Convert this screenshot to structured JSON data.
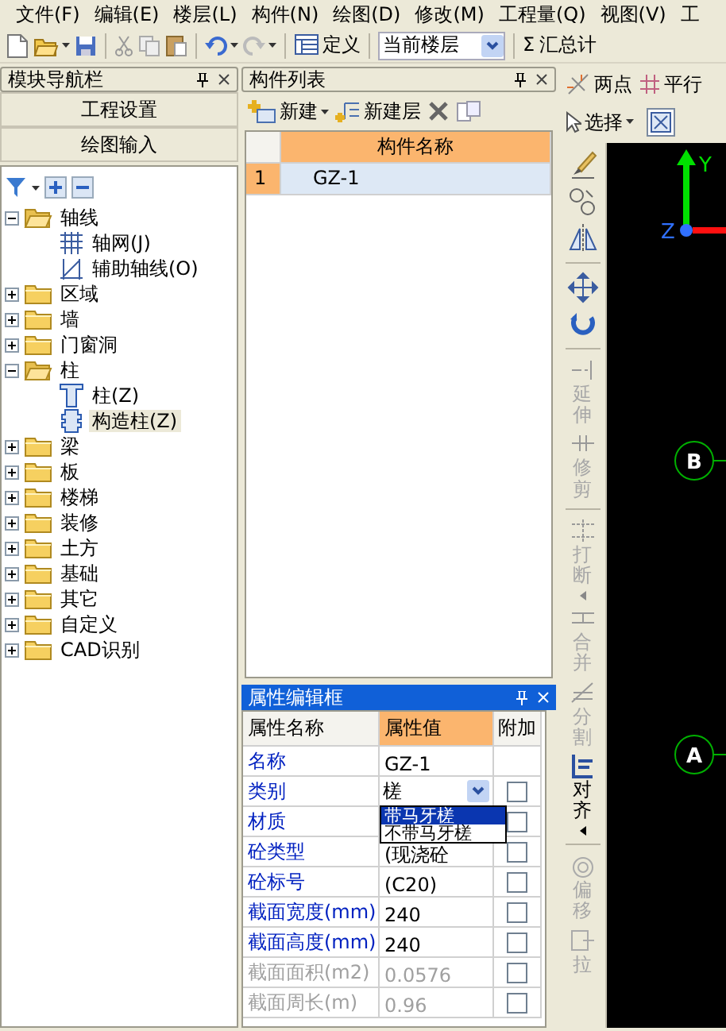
{
  "menu_bar": [
    "文件(F)",
    "编辑(E)",
    "楼层(L)",
    "构件(N)",
    "绘图(D)",
    "修改(M)",
    "工程量(Q)",
    "视图(V)",
    "工"
  ],
  "toolbar": {
    "define_button": "定义",
    "floor_select": "当前楼层",
    "summary_symbol": "Σ",
    "summary_button": "汇总计"
  },
  "module_nav": {
    "title": "模块导航栏",
    "buttons": [
      "工程设置",
      "绘图输入"
    ],
    "tree": [
      {
        "label": "轴线",
        "expanded": true,
        "children": [
          {
            "label": "轴网(J)",
            "kind": "axis-grid",
            "selected": false
          },
          {
            "label": "辅助轴线(O)",
            "kind": "aux-axis",
            "selected": false
          }
        ]
      },
      {
        "label": "区域",
        "expanded": false
      },
      {
        "label": "墙",
        "expanded": false
      },
      {
        "label": "门窗洞",
        "expanded": false
      },
      {
        "label": "柱",
        "expanded": true,
        "children": [
          {
            "label": "柱(Z)",
            "kind": "column",
            "selected": false
          },
          {
            "label": "构造柱(Z)",
            "kind": "constructional-column",
            "selected": true
          }
        ]
      },
      {
        "label": "梁",
        "expanded": false
      },
      {
        "label": "板",
        "expanded": false
      },
      {
        "label": "楼梯",
        "expanded": false
      },
      {
        "label": "装修",
        "expanded": false
      },
      {
        "label": "土方",
        "expanded": false
      },
      {
        "label": "基础",
        "expanded": false
      },
      {
        "label": "其它",
        "expanded": false
      },
      {
        "label": "自定义",
        "expanded": false
      },
      {
        "label": "CAD识别",
        "expanded": false
      }
    ]
  },
  "component_list": {
    "title": "构件列表",
    "new_button": "新建",
    "new_layer_button": "新建层",
    "columns": [
      "构件名称"
    ],
    "rows": [
      {
        "index": "1",
        "name": "GZ-1",
        "selected": true
      }
    ]
  },
  "property_editor": {
    "title": "属性编辑框",
    "columns": [
      "属性名称",
      "属性值",
      "附加"
    ],
    "rows": [
      {
        "name": "名称",
        "value": "GZ-1",
        "kind": "text",
        "disabled": false
      },
      {
        "name": "类别",
        "value": "槎",
        "kind": "combo",
        "disabled": false,
        "checked": false,
        "options": [
          {
            "label": "带马牙槎",
            "selected": true
          },
          {
            "label": "不带马牙槎",
            "selected": false
          }
        ]
      },
      {
        "name": "材质",
        "kind": "text",
        "disabled": false,
        "checked": false
      },
      {
        "name": "砼类型",
        "value": "(现浇砼",
        "kind": "text",
        "disabled": false,
        "checked": false
      },
      {
        "name": "砼标号",
        "value": "(C20)",
        "kind": "text",
        "disabled": false,
        "checked": false
      },
      {
        "name": "截面宽度(mm)",
        "value": "240",
        "kind": "text",
        "disabled": false,
        "checked": false
      },
      {
        "name": "截面高度(mm)",
        "value": "240",
        "kind": "text",
        "disabled": false,
        "checked": false
      },
      {
        "name": "截面面积(m2)",
        "value": "0.0576",
        "kind": "text",
        "disabled": true,
        "checked": false
      },
      {
        "name": "截面周长(m)",
        "value": "0.96",
        "kind": "text",
        "disabled": true,
        "checked": false
      }
    ]
  },
  "draw_toolbar": {
    "buttons": [
      "两点",
      "平行"
    ],
    "select_button": "选择"
  },
  "edit_toolbar": [
    {
      "label": "延伸",
      "disabled": true
    },
    {
      "label": "修剪",
      "disabled": true,
      "separator_after": true
    },
    {
      "label": "打断",
      "disabled": true,
      "submenu": true
    },
    {
      "label": "合并",
      "disabled": true
    },
    {
      "label": "分割",
      "disabled": true
    },
    {
      "label": "对齐",
      "disabled": false,
      "submenu": true,
      "separator_after": true
    },
    {
      "label": "偏移",
      "disabled": true
    },
    {
      "label": "拉",
      "disabled": true
    }
  ],
  "canvas": {
    "axis_labels": [
      "Y",
      "Z"
    ],
    "grid_bubbles": [
      "B",
      "A"
    ]
  }
}
